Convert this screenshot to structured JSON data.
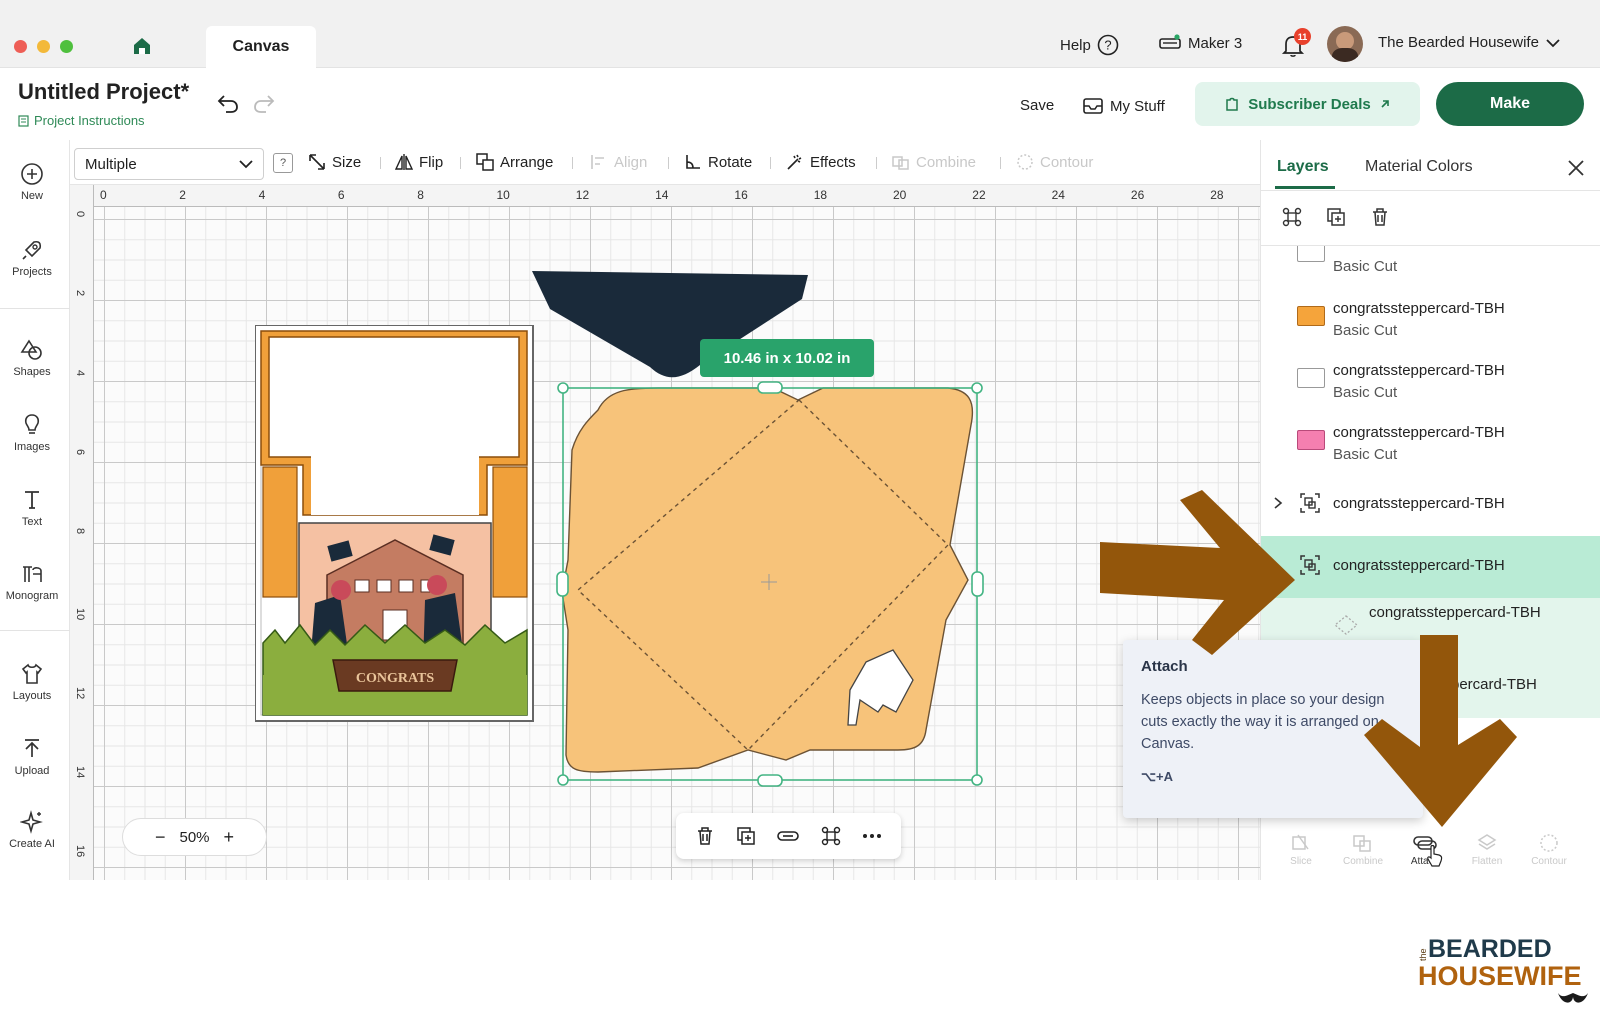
{
  "titlebar": {
    "tab_label": "Canvas",
    "help_label": "Help",
    "machine_label": "Maker 3",
    "notification_count": "11",
    "user_name": "The Bearded Housewife"
  },
  "project": {
    "title": "Untitled Project*",
    "instructions_label": "Project Instructions",
    "save_label": "Save",
    "mystuff_label": "My Stuff",
    "subscriber_label": "Subscriber Deals",
    "make_label": "Make"
  },
  "left_nav": [
    {
      "label": "New",
      "icon": "plus-circle-icon"
    },
    {
      "label": "Projects",
      "icon": "rocket-icon"
    },
    {
      "label": "Shapes",
      "icon": "shapes-icon"
    },
    {
      "label": "Images",
      "icon": "lightbulb-icon"
    },
    {
      "label": "Text",
      "icon": "text-icon"
    },
    {
      "label": "Monogram",
      "icon": "monogram-icon"
    },
    {
      "label": "Layouts",
      "icon": "shirt-icon"
    },
    {
      "label": "Upload",
      "icon": "upload-icon"
    },
    {
      "label": "Create AI",
      "icon": "sparkle-icon"
    }
  ],
  "toolbar": {
    "select_value": "Multiple",
    "help_glyph": "?",
    "size_label": "Size",
    "flip_label": "Flip",
    "arrange_label": "Arrange",
    "align_label": "Align",
    "rotate_label": "Rotate",
    "effects_label": "Effects",
    "combine_label": "Combine",
    "contour_label": "Contour"
  },
  "canvas": {
    "ruler_x": [
      "0",
      "2",
      "4",
      "6",
      "8",
      "10",
      "12",
      "14",
      "16",
      "18",
      "20",
      "22",
      "24",
      "26",
      "28"
    ],
    "ruler_y": [
      "0",
      "2",
      "4",
      "6",
      "8",
      "10",
      "12",
      "14",
      "16"
    ],
    "card_banner_text": "CONGRATS",
    "dimension_label": "10.46  in x 10.02  in",
    "zoom_label": "50%",
    "zoom_minus": "−",
    "zoom_plus": "+"
  },
  "right_panel": {
    "tab_layers": "Layers",
    "tab_colors": "Material Colors",
    "layers": [
      {
        "name": "",
        "op": "Basic Cut",
        "color": "#ffffff"
      },
      {
        "name": "congratssteppercard-TBH",
        "op": "Basic Cut",
        "color": "#f5a43b"
      },
      {
        "name": "congratssteppercard-TBH",
        "op": "Basic Cut",
        "color": "#ffffff"
      },
      {
        "name": "congratssteppercard-TBH",
        "op": "Basic Cut",
        "color": "#f57fb0"
      },
      {
        "name": "congratssteppercard-TBH",
        "op": ""
      },
      {
        "name": "congratssteppercard-TBH",
        "op": ""
      },
      {
        "name": "congratssteppercard-TBH",
        "op": ""
      },
      {
        "name": "percard-TBH",
        "op": ""
      }
    ],
    "bottom_tools": [
      "Slice",
      "Combine",
      "Attach",
      "Flatten",
      "Contour"
    ]
  },
  "tooltip": {
    "title": "Attach",
    "body": "Keeps objects in place so your design cuts exactly the way it is arranged on Canvas.",
    "shortcut": "⌥+A"
  },
  "logo": {
    "line1": "BEARDED",
    "line2": "HOUSEWIFE",
    "prefix": "the"
  },
  "colors": {
    "accent_green": "#1c6b47",
    "selection_green": "#29a36b",
    "envelope_fill": "#f7c37a",
    "cap_navy": "#1a2a3a",
    "arrow_brown": "#93560b",
    "layer_selected": "#b9ebd5"
  }
}
